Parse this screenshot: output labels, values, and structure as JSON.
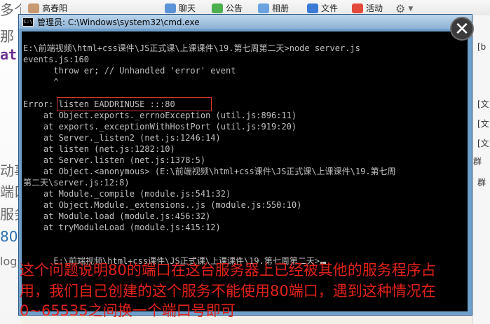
{
  "background": {
    "left_fragments": [
      "多个",
      "那",
      "at",
      "动事",
      "端口",
      "服务",
      "80",
      "log"
    ],
    "top_bar": {
      "user_name": "高春阳",
      "items": [
        "聊天",
        "公告",
        "相册",
        "文件",
        "活动"
      ]
    },
    "right_items": [
      "[b",
      "[文",
      "[文",
      "[文",
      "群",
      "群"
    ]
  },
  "close_symbol": "✕",
  "cmd": {
    "icon_text": "C:\\",
    "title": "管理员: C:\\Windows\\system32\\cmd.exe",
    "lines": [
      "E:\\前端视频\\html+css课件\\JS正式课\\上课课件\\19.第七周第二天>node server.js",
      "events.js:160",
      "      throw er; // Unhandled 'error' event",
      "      ^",
      "",
      "Error: listen EADDRINUSE :::80",
      "    at Object.exports._errnoException (util.js:896:11)",
      "    at exports._exceptionWithHostPort (util.js:919:20)",
      "    at Server._listen2 (net.js:1246:14)",
      "    at listen (net.js:1282:10)",
      "    at Server.listen (net.js:1378:5)",
      "    at Object.<anonymous> (E:\\前端视频\\html+css课件\\JS正式课\\上课课件\\19.第七周",
      "第二天\\server.js:12:8)",
      "    at Module._compile (module.js:541:32)",
      "    at Object.Module._extensions..js (module.js:550:10)",
      "    at Module.load (module.js:456:32)",
      "    at tryModuleLoad (module.js:415:12)",
      "",
      "E:\\前端视频\\html+css课件\\JS正式课\\上课课件\\19.第七周第二天>"
    ]
  },
  "annotation": {
    "line1": "这个问题说明80的端口在这台服务器上已经被其他的服务程序占",
    "line2": "用，我们自己创建的这个服务不能使用80端口，遇到这种情况在",
    "line3": "0~65535之间换一个端口号即可"
  },
  "colors": {
    "annotation": "#e0221a",
    "console_bg": "#000000",
    "console_text": "#c0c0c0",
    "highlight_box": "#e03a2a"
  }
}
